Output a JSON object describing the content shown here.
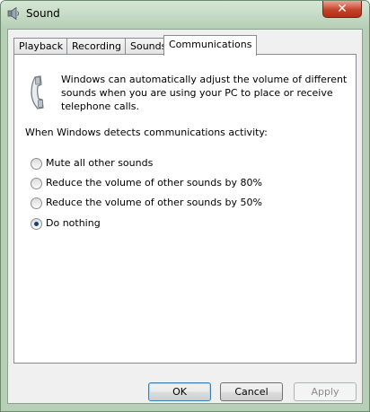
{
  "window": {
    "title": "Sound",
    "close_label": "✕"
  },
  "tabs": [
    {
      "label": "Playback",
      "active": false
    },
    {
      "label": "Recording",
      "active": false
    },
    {
      "label": "Sounds",
      "active": false
    },
    {
      "label": "Communications",
      "active": true
    }
  ],
  "communications": {
    "description": "Windows can automatically adjust the volume of different sounds when you are using your PC to place or receive telephone calls.",
    "detect_label": "When Windows detects communications activity:",
    "options": [
      {
        "label": "Mute all other sounds",
        "checked": false
      },
      {
        "label": "Reduce the volume of other sounds by 80%",
        "checked": false
      },
      {
        "label": "Reduce the volume of other sounds by 50%",
        "checked": false
      },
      {
        "label": "Do nothing",
        "checked": true
      }
    ]
  },
  "buttons": {
    "ok": "OK",
    "cancel": "Cancel",
    "apply": "Apply"
  }
}
